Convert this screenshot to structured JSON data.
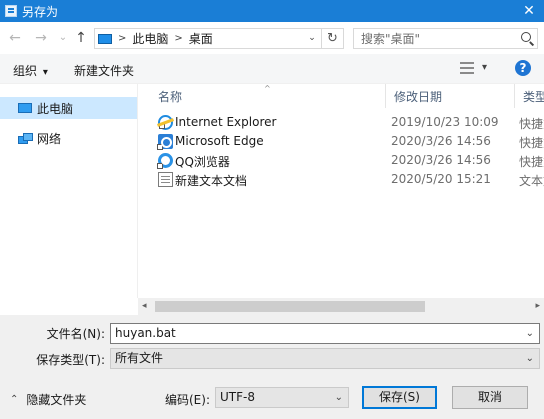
{
  "window": {
    "title": "另存为",
    "close_glyph": "✕"
  },
  "nav": {
    "back_glyph": "←",
    "forward_glyph": "→",
    "recent_glyph": "⌄",
    "up_glyph": "↑",
    "breadcrumbs": [
      "此电脑",
      "桌面"
    ],
    "separator_glyph": ">",
    "refresh_glyph": "↻",
    "search_placeholder": "搜索\"桌面\""
  },
  "toolbar": {
    "organize_label": "组织",
    "organize_caret": "▾",
    "new_folder_label": "新建文件夹",
    "view_caret": "▾",
    "help_glyph": "?"
  },
  "sidebar": {
    "items": [
      {
        "label": "此电脑",
        "icon": "computer-icon",
        "selected": true
      },
      {
        "label": "网络",
        "icon": "network-icon",
        "selected": false
      }
    ]
  },
  "filelist": {
    "columns": {
      "name": "名称",
      "date": "修改日期",
      "type": "类型"
    },
    "sort_glyph": "^",
    "rows": [
      {
        "name": "Internet Explorer",
        "date": "2019/10/23 10:09",
        "type": "快捷方式",
        "icon": "internet-explorer-icon"
      },
      {
        "name": "Microsoft Edge",
        "date": "2020/3/26 14:56",
        "type": "快捷方式",
        "icon": "microsoft-edge-icon"
      },
      {
        "name": "QQ浏览器",
        "date": "2020/3/26 14:56",
        "type": "快捷方式",
        "icon": "qq-browser-icon"
      },
      {
        "name": "新建文本文档",
        "date": "2020/5/20 15:21",
        "type": "文本文档",
        "icon": "text-document-icon"
      }
    ]
  },
  "scrollbar": {
    "left_glyph": "◂",
    "right_glyph": "▸"
  },
  "form": {
    "filename_label": "文件名(N):",
    "filename_value": "huyan.bat",
    "filetype_label": "保存类型(T):",
    "filetype_value": "所有文件",
    "encoding_label": "编码(E):",
    "encoding_value": "UTF-8",
    "hide_folders_label": "隐藏文件夹",
    "hide_folders_glyph": "⌃",
    "save_label": "保存(S)",
    "cancel_label": "取消",
    "caret_glyph": "⌄"
  },
  "colors": {
    "titlebar": "#1a7ed6",
    "selection": "#cce8ff",
    "accent": "#0078d7"
  }
}
